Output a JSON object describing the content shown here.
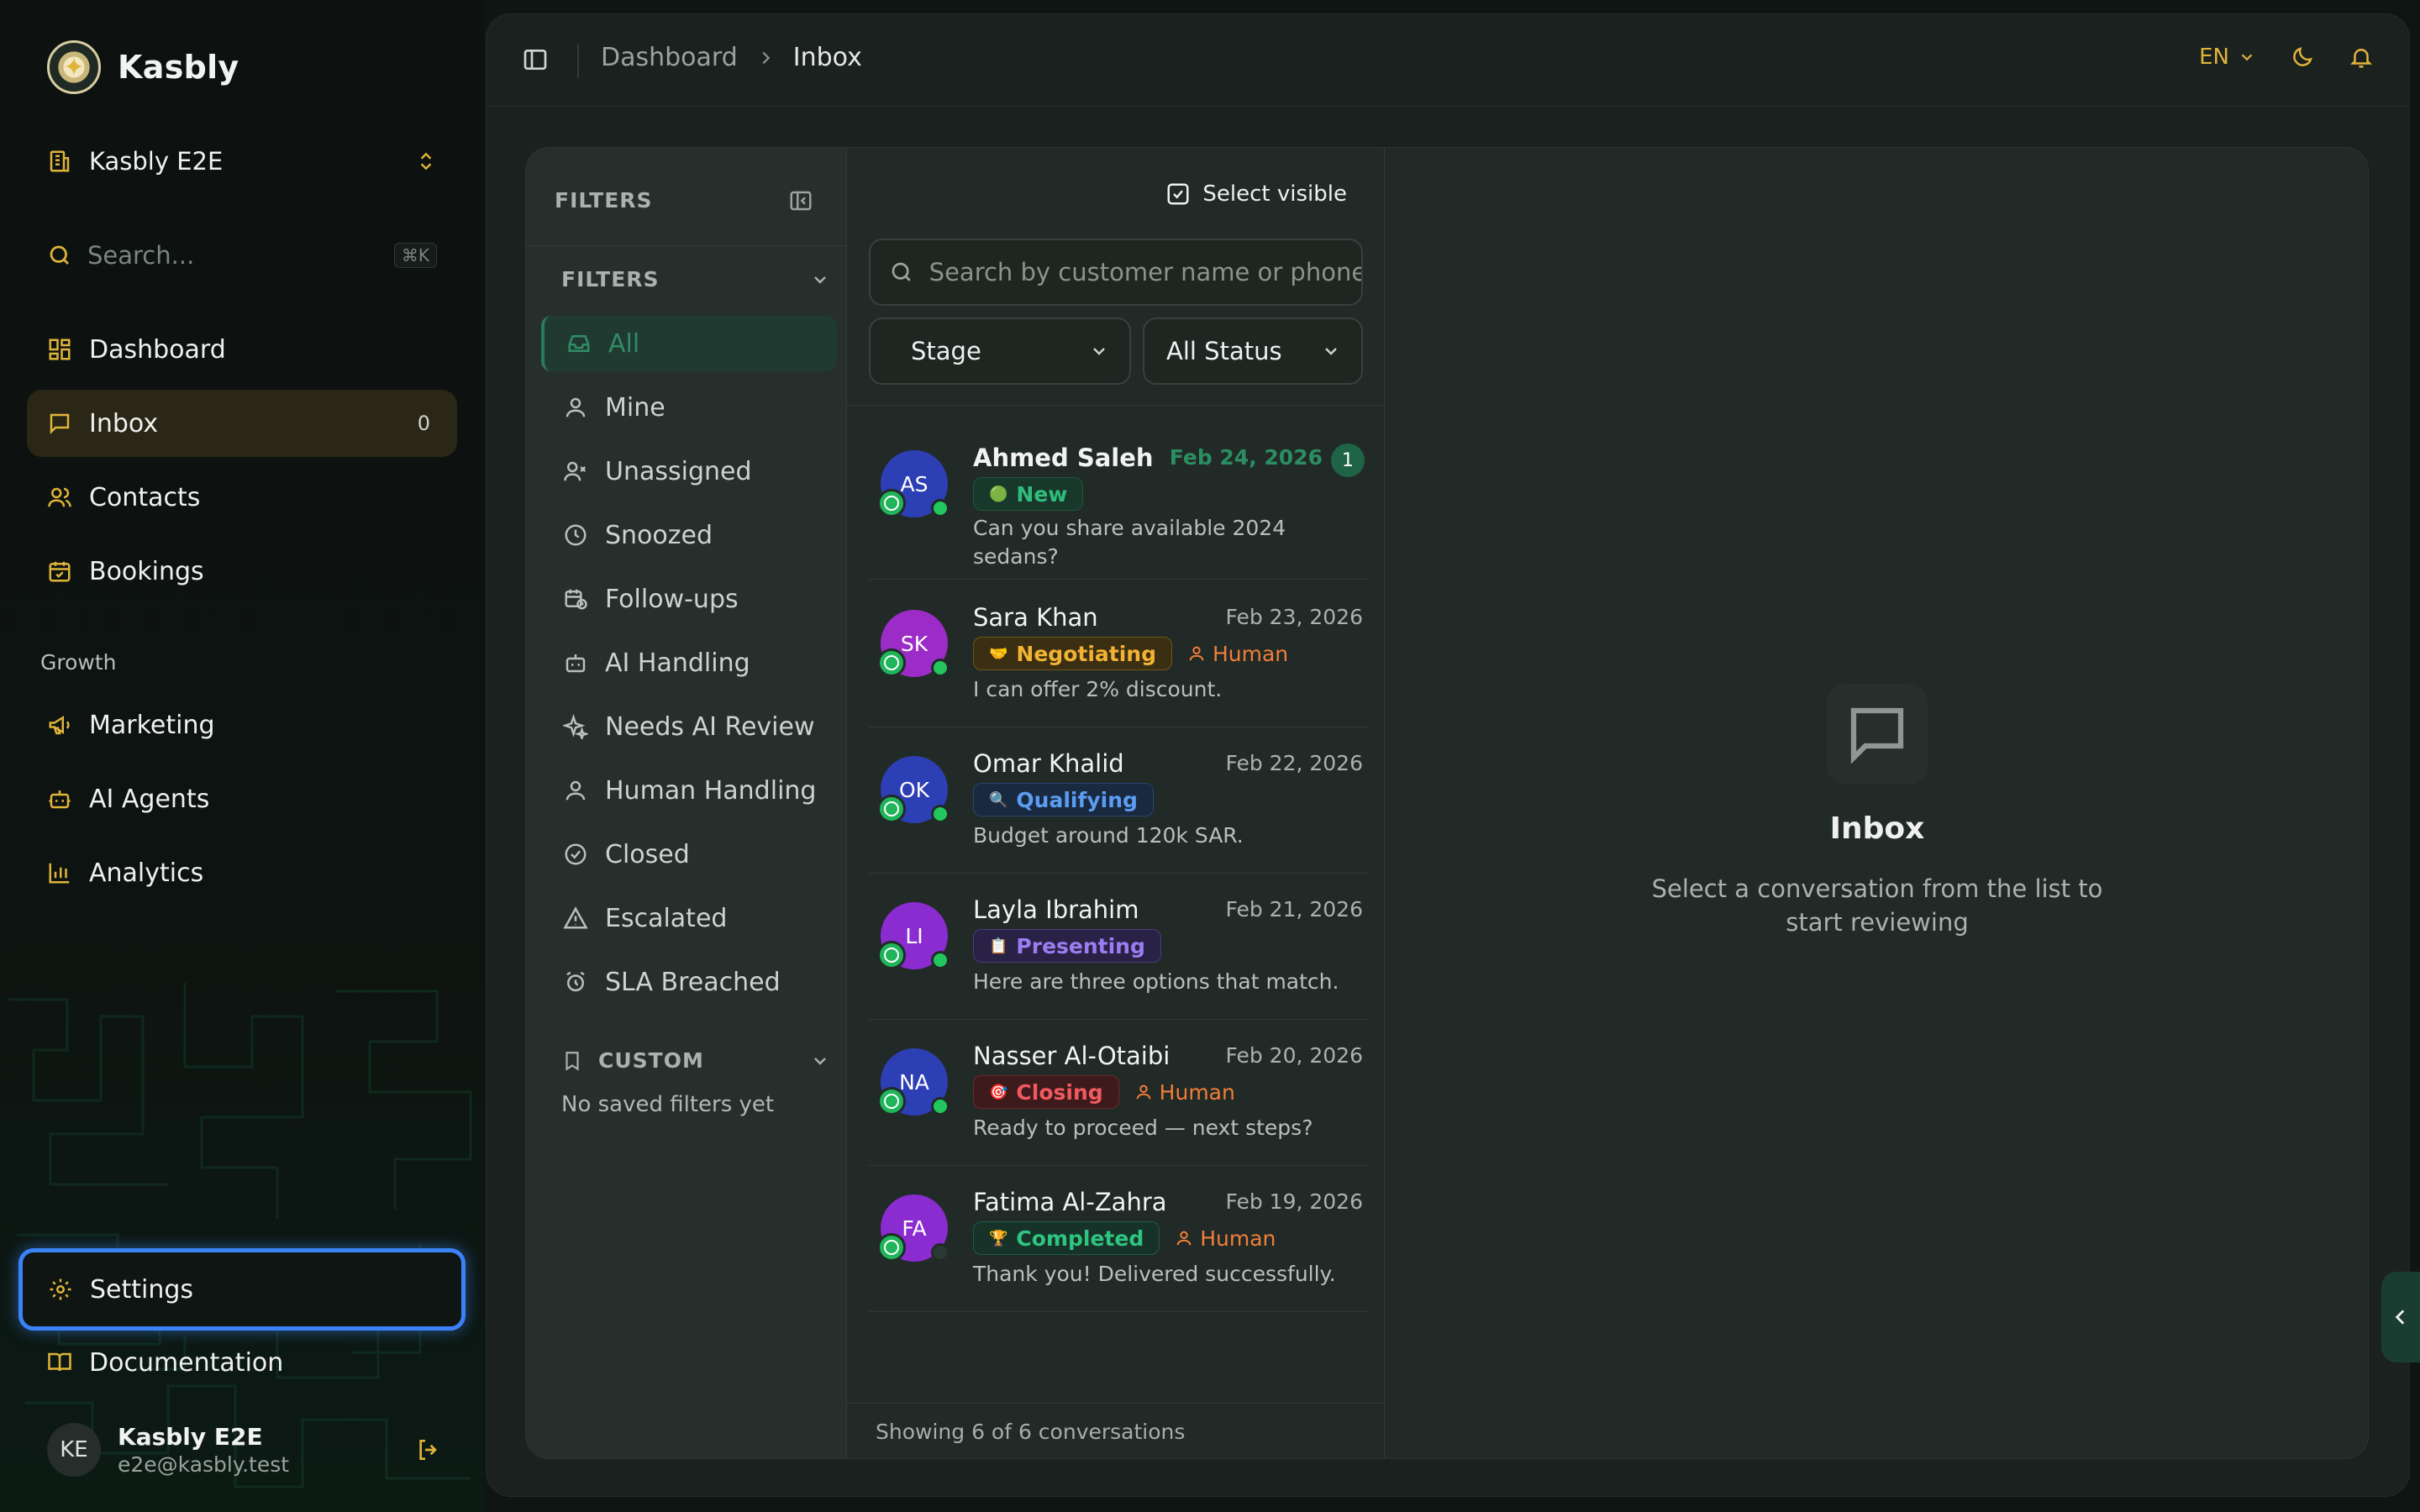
{
  "sidebar": {
    "brand": "Kasbly",
    "workspace": "Kasbly E2E",
    "search_placeholder": "Search...",
    "search_shortcut": "⌘K",
    "nav": [
      {
        "label": "Dashboard",
        "icon": "dashboard-icon"
      },
      {
        "label": "Inbox",
        "icon": "inbox-icon",
        "count": "0",
        "active": true
      },
      {
        "label": "Contacts",
        "icon": "contacts-icon"
      },
      {
        "label": "Bookings",
        "icon": "calendar-icon"
      }
    ],
    "growth_label": "Growth",
    "growth": [
      {
        "label": "Marketing",
        "icon": "megaphone-icon"
      },
      {
        "label": "AI Agents",
        "icon": "bot-icon"
      },
      {
        "label": "Analytics",
        "icon": "chart-icon"
      }
    ],
    "settings": "Settings",
    "documentation": "Documentation",
    "user": {
      "initials": "KE",
      "name": "Kasbly E2E",
      "email": "e2e@kasbly.test"
    }
  },
  "topbar": {
    "breadcrumb": [
      "Dashboard",
      "Inbox"
    ],
    "language": "EN"
  },
  "filters": {
    "header": "FILTERS",
    "group_title": "FILTERS",
    "items": [
      {
        "label": "All",
        "icon": "inbox-icon",
        "active": true
      },
      {
        "label": "Mine",
        "icon": "user-icon"
      },
      {
        "label": "Unassigned",
        "icon": "user-x-icon"
      },
      {
        "label": "Snoozed",
        "icon": "clock-icon"
      },
      {
        "label": "Follow-ups",
        "icon": "calendar-clock-icon"
      },
      {
        "label": "AI Handling",
        "icon": "bot-icon"
      },
      {
        "label": "Needs AI Review",
        "icon": "sparkles-icon"
      },
      {
        "label": "Human Handling",
        "icon": "user-icon"
      },
      {
        "label": "Closed",
        "icon": "check-circle-icon"
      },
      {
        "label": "Escalated",
        "icon": "warning-icon"
      },
      {
        "label": "SLA Breached",
        "icon": "alarm-icon"
      }
    ],
    "custom_title": "CUSTOM",
    "no_saved": "No saved filters yet"
  },
  "conversations": {
    "select_visible": "Select visible",
    "search_placeholder": "Search by customer name or phone",
    "stage_label": "Stage",
    "status_label": "All Status",
    "items": [
      {
        "initials": "AS",
        "avatar_color": "#2d3fb5",
        "online_color": "#22c55e",
        "name": "Ahmed Saleh",
        "date": "Feb 24, 2026",
        "unread": "1",
        "stage": "New",
        "stage_icon": "🟢",
        "human": "",
        "preview": "Can you share available 2024 sedans?"
      },
      {
        "initials": "SK",
        "avatar_color": "#9b2cc7",
        "online_color": "#22c55e",
        "name": "Sara Khan",
        "date": "Feb 23, 2026",
        "unread": "",
        "stage": "Negotiating",
        "stage_icon": "🤝",
        "human": "Human",
        "preview": "I can offer 2% discount."
      },
      {
        "initials": "OK",
        "avatar_color": "#2d3fb5",
        "online_color": "#22c55e",
        "name": "Omar Khalid",
        "date": "Feb 22, 2026",
        "unread": "",
        "stage": "Qualifying",
        "stage_icon": "🔍",
        "human": "",
        "preview": "Budget around 120k SAR."
      },
      {
        "initials": "LI",
        "avatar_color": "#8a2ccf",
        "online_color": "#22c55e",
        "name": "Layla Ibrahim",
        "date": "Feb 21, 2026",
        "unread": "",
        "stage": "Presenting",
        "stage_icon": "📋",
        "human": "",
        "preview": "Here are three options that match."
      },
      {
        "initials": "NA",
        "avatar_color": "#2d3fb5",
        "online_color": "#22c55e",
        "name": "Nasser Al-Otaibi",
        "date": "Feb 20, 2026",
        "unread": "",
        "stage": "Closing",
        "stage_icon": "🎯",
        "human": "Human",
        "preview": "Ready to proceed — next steps?"
      },
      {
        "initials": "FA",
        "avatar_color": "#8a2ccf",
        "online_color": "#2a3a33",
        "name": "Fatima Al-Zahra",
        "date": "Feb 19, 2026",
        "unread": "",
        "stage": "Completed",
        "stage_icon": "🏆",
        "human": "Human",
        "preview": "Thank you! Delivered successfully."
      }
    ],
    "footer": "Showing 6 of 6 conversations"
  },
  "empty_state": {
    "title": "Inbox",
    "subtitle": "Select a conversation from the list to start reviewing"
  },
  "colors": {
    "accent_gold": "#e0b43a",
    "accent_green": "#2e8c67",
    "focus_blue": "#3b82f6"
  }
}
